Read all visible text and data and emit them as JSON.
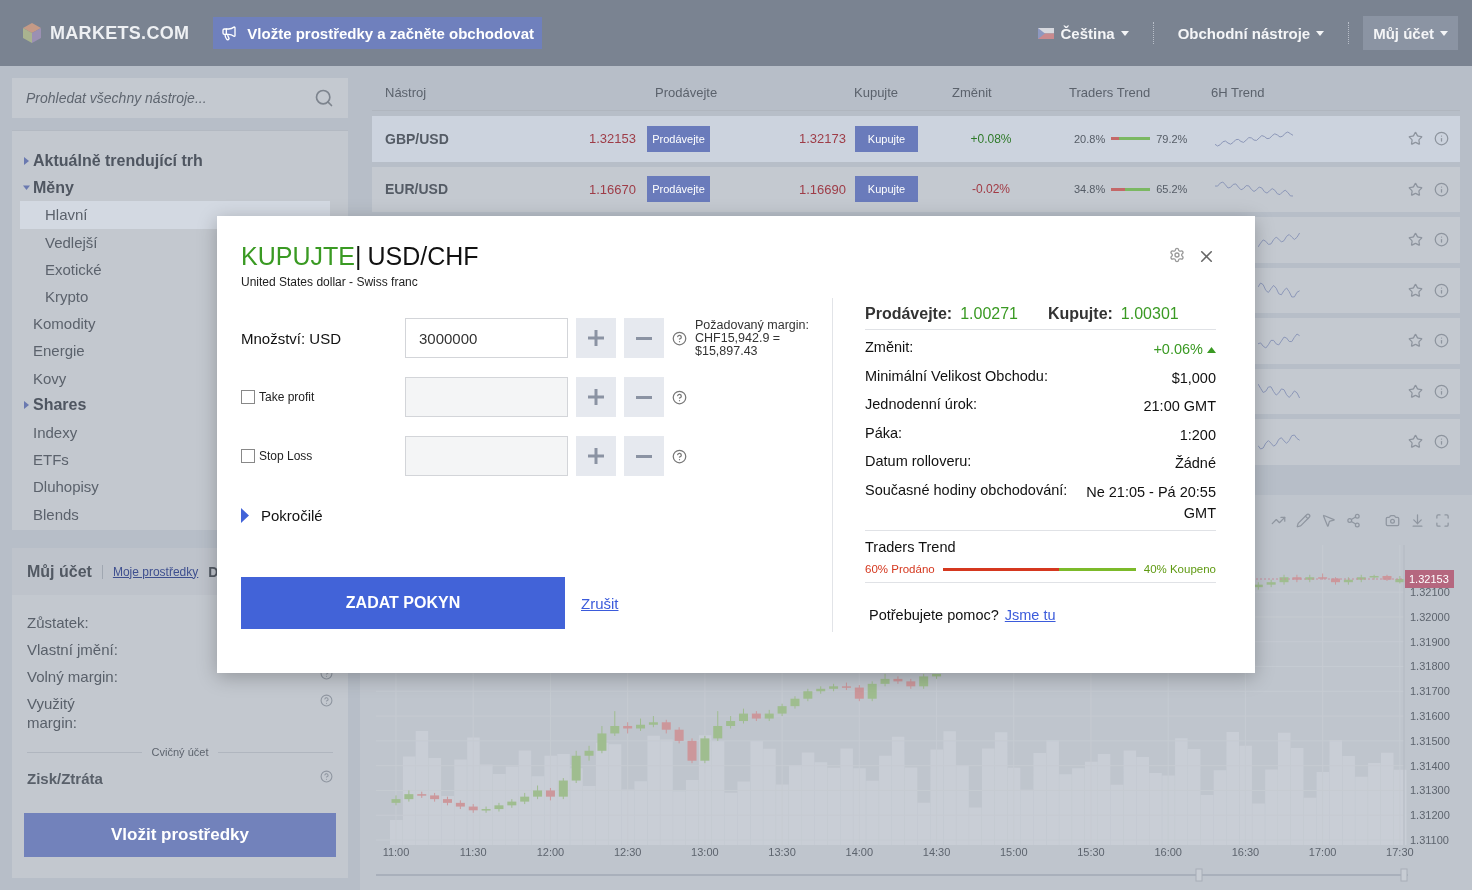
{
  "header": {
    "logo": "MARKETS.COM",
    "promo": "Vložte prostředky a začněte obchodovat",
    "language": "Čeština",
    "menus": [
      {
        "label": "Obchodní nástroje",
        "boxed": false
      },
      {
        "label": "Můj účet",
        "boxed": true
      }
    ]
  },
  "sidebar": {
    "search_placeholder": "Prohledat všechny nástroje...",
    "tree": [
      {
        "kind": "group",
        "label": "Aktuálně trendující trh",
        "expanded": false
      },
      {
        "kind": "group",
        "label": "Měny",
        "expanded": true,
        "children": [
          {
            "label": "Hlavní",
            "selected": true
          },
          {
            "label": "Vedlejší",
            "selected": false
          },
          {
            "label": "Exotické",
            "selected": false
          },
          {
            "label": "Krypto",
            "selected": false
          }
        ]
      },
      {
        "kind": "leaf",
        "label": "Komodity"
      },
      {
        "kind": "leaf",
        "label": "Energie"
      },
      {
        "kind": "leaf",
        "label": "Kovy"
      },
      {
        "kind": "group",
        "label": "Shares",
        "expanded": false
      },
      {
        "kind": "leaf",
        "label": "Indexy"
      },
      {
        "kind": "leaf",
        "label": "ETFs"
      },
      {
        "kind": "leaf",
        "label": "Dluhopisy"
      },
      {
        "kind": "leaf",
        "label": "Blends"
      }
    ]
  },
  "account": {
    "title": "Můj účet",
    "link": "Moje prostředky",
    "cut_tab": "D",
    "fields": [
      {
        "label": "Zůstatek:"
      },
      {
        "label": "Vlastní jmění:"
      },
      {
        "label": "Volný margin:",
        "help": true
      },
      {
        "label": "Využitý margin:",
        "help": true
      }
    ],
    "practice_label": "Cvičný účet",
    "profit": {
      "label": "Zisk/Ztráta",
      "help": true
    },
    "deposit_button": "Vložit prostředky"
  },
  "table": {
    "columns": [
      "Nástroj",
      "Prodávejte",
      "Kupujte",
      "Změnit",
      "Traders Trend",
      "6H Trend"
    ],
    "rows": [
      {
        "kind": "full",
        "instrument": "GBP/USD",
        "sell_price": "1.32153",
        "sell_button": "Prodávejte",
        "buy_price": "1.32173",
        "buy_button": "Kupujte",
        "change": "+0.08%",
        "rising": true,
        "trend_sold": "20.8%",
        "level": 0.208,
        "trend_bought": "79.2%",
        "highlighted": true
      },
      {
        "kind": "full",
        "instrument": "EUR/USD",
        "sell_price": "1.16670",
        "sell_button": "Prodávejte",
        "buy_price": "1.16690",
        "buy_button": "Kupujte",
        "change": "-0.02%",
        "rising": false,
        "trend_sold": "34.8%",
        "level": 0.348,
        "trend_bought": "65.2%",
        "highlighted": false
      },
      {
        "kind": "covered"
      },
      {
        "kind": "covered"
      },
      {
        "kind": "covered"
      },
      {
        "kind": "covered"
      },
      {
        "kind": "covered"
      }
    ]
  },
  "chart": {
    "price_tag": "1.32153",
    "chart_data": {
      "type": "candlestick",
      "grid": true,
      "categories": [
        "11:00",
        null,
        null,
        null,
        null,
        null,
        "11:30",
        null,
        null,
        null,
        null,
        null,
        "12:00",
        null,
        null,
        null,
        null,
        null,
        "12:30",
        null,
        null,
        null,
        null,
        null,
        "13:00",
        null,
        null,
        null,
        null,
        null,
        "13:30",
        null,
        null,
        null,
        null,
        null,
        "14:00",
        null,
        null,
        null,
        null,
        null,
        "14:30",
        null,
        null,
        null,
        null,
        null,
        "15:00",
        null,
        null,
        null,
        null,
        null,
        "15:30",
        null,
        null,
        null,
        null,
        null,
        "16:00",
        null,
        null,
        null,
        null,
        null,
        "16:30",
        null,
        null,
        null,
        null,
        null,
        "17:00",
        null,
        null,
        null,
        null,
        null,
        "17:30"
      ],
      "ohlc": [
        [
          1.3125,
          1.3128,
          1.3124,
          1.31265
        ],
        [
          1.31265,
          1.313,
          1.31255,
          1.31285
        ],
        [
          1.31285,
          1.31295,
          1.3127,
          1.3128
        ],
        [
          1.3128,
          1.3129,
          1.31255,
          1.31265
        ],
        [
          1.31265,
          1.31275,
          1.3124,
          1.3125
        ],
        [
          1.3125,
          1.3126,
          1.31225,
          1.31235
        ],
        [
          1.31235,
          1.31245,
          1.3121,
          1.3122
        ],
        [
          1.3122,
          1.31235,
          1.3121,
          1.31225
        ],
        [
          1.31225,
          1.3125,
          1.31215,
          1.3124
        ],
        [
          1.3124,
          1.31265,
          1.3123,
          1.31255
        ],
        [
          1.31255,
          1.3129,
          1.31245,
          1.31275
        ],
        [
          1.31275,
          1.3132,
          1.31265,
          1.313
        ],
        [
          1.313,
          1.3131,
          1.3126,
          1.31275
        ],
        [
          1.31275,
          1.3135,
          1.31265,
          1.3134
        ],
        [
          1.3134,
          1.3146,
          1.3133,
          1.3144
        ],
        [
          1.3144,
          1.3148,
          1.3142,
          1.3146
        ],
        [
          1.3146,
          1.3156,
          1.3145,
          1.3153
        ],
        [
          1.3153,
          1.3162,
          1.3152,
          1.3156
        ],
        [
          1.3156,
          1.31575,
          1.3153,
          1.3155
        ],
        [
          1.3155,
          1.3159,
          1.3154,
          1.31565
        ],
        [
          1.31565,
          1.316,
          1.31555,
          1.31575
        ],
        [
          1.31575,
          1.31585,
          1.3153,
          1.31545
        ],
        [
          1.31545,
          1.31555,
          1.3149,
          1.315
        ],
        [
          1.315,
          1.3151,
          1.3141,
          1.3142
        ],
        [
          1.3142,
          1.3152,
          1.3141,
          1.3151
        ],
        [
          1.3151,
          1.3162,
          1.315,
          1.3156
        ],
        [
          1.3156,
          1.316,
          1.3155,
          1.3158
        ],
        [
          1.3158,
          1.3163,
          1.3157,
          1.3161
        ],
        [
          1.3161,
          1.3162,
          1.3158,
          1.3159
        ],
        [
          1.3159,
          1.31625,
          1.3158,
          1.3161
        ],
        [
          1.3161,
          1.3165,
          1.316,
          1.3164
        ],
        [
          1.3164,
          1.3168,
          1.3163,
          1.3167
        ],
        [
          1.3167,
          1.3171,
          1.3166,
          1.317
        ],
        [
          1.317,
          1.3172,
          1.3169,
          1.3171
        ],
        [
          1.3171,
          1.3173,
          1.317,
          1.3172
        ],
        [
          1.3172,
          1.31735,
          1.31705,
          1.31715
        ],
        [
          1.31715,
          1.31725,
          1.3166,
          1.3167
        ],
        [
          1.3167,
          1.3174,
          1.3166,
          1.3173
        ],
        [
          1.3173,
          1.3177,
          1.3172,
          1.3175
        ],
        [
          1.3175,
          1.3176,
          1.3173,
          1.3174
        ],
        [
          1.3174,
          1.3175,
          1.3171,
          1.3172
        ],
        [
          1.3172,
          1.3177,
          1.3171,
          1.3176
        ],
        [
          1.3176,
          1.3177,
          1.3175,
          1.3177
        ],
        null,
        null,
        null,
        null,
        null,
        null,
        null,
        null,
        null,
        null,
        null,
        null,
        null,
        null,
        null,
        null,
        null,
        null,
        null,
        null,
        null,
        null,
        null,
        null,
        [
          1.3212,
          1.3214,
          1.3211,
          1.3213
        ],
        [
          1.3213,
          1.3215,
          1.3212,
          1.3214
        ],
        [
          1.3214,
          1.3217,
          1.3213,
          1.3216
        ],
        [
          1.3216,
          1.3217,
          1.3214,
          1.3215
        ],
        [
          1.3215,
          1.3217,
          1.3214,
          1.3216
        ],
        [
          1.3216,
          1.32175,
          1.3215,
          1.32155
        ],
        [
          1.32155,
          1.3216,
          1.3213,
          1.3214
        ],
        [
          1.3214,
          1.3216,
          1.3213,
          1.3215
        ],
        [
          1.3215,
          1.3217,
          1.3214,
          1.3216
        ],
        [
          1.3216,
          1.3217,
          1.3215,
          1.32165
        ],
        [
          1.32165,
          1.3217,
          1.32145,
          1.3215
        ],
        [
          1.3214,
          1.32165,
          1.32135,
          1.32153
        ]
      ],
      "ylim": [
        1.3108,
        1.3229
      ],
      "yticks": [
        {
          "value": 1.321,
          "label": "1.32100"
        },
        {
          "value": 1.32,
          "label": "1.32000"
        },
        {
          "value": 1.319,
          "label": "1.31900"
        },
        {
          "value": 1.318,
          "label": "1.31800"
        },
        {
          "value": 1.317,
          "label": "1.31700"
        },
        {
          "value": 1.316,
          "label": "1.31600"
        },
        {
          "value": 1.315,
          "label": "1.31500"
        },
        {
          "value": 1.314,
          "label": "1.31400"
        },
        {
          "value": 1.313,
          "label": "1.31300"
        },
        {
          "value": 1.312,
          "label": "1.31200"
        },
        {
          "value": 1.311,
          "label": "1.31100"
        }
      ]
    }
  },
  "modal": {
    "action": "KUPUJTE",
    "separator": "|",
    "instrument": "USD/CHF",
    "description": "United States dollar - Swiss franc",
    "fields": [
      {
        "kind": "quantity",
        "label": "Množství: USD",
        "value": "3000000",
        "note": "Požadovaný margin: CHF15,942.9 = $15,897.43"
      },
      {
        "kind": "optional",
        "label": "Take profit",
        "checked": false
      },
      {
        "kind": "optional",
        "label": "Stop Loss",
        "checked": false
      }
    ],
    "advanced": {
      "label": "Pokročilé",
      "expanded": false
    },
    "submit": "ZADAT POKYN",
    "cancel": "Zrušit",
    "sell_label": "Prodávejte:",
    "sell_price": "1.00271",
    "buy_label": "Kupujte:",
    "buy_price": "1.00301",
    "details": [
      {
        "kind": "change",
        "label": "Změnit:",
        "value": "+0.06%",
        "rising": true
      },
      {
        "kind": "plain",
        "label": "Minimální Velikost Obchodu:",
        "value": "$1,000"
      },
      {
        "kind": "plain",
        "label": "Jednodenní úrok:",
        "value": "21:00 GMT"
      },
      {
        "kind": "plain",
        "label": "Páka:",
        "value": "1:200"
      },
      {
        "kind": "plain",
        "label": "Datum rolloveru:",
        "value": "Žádné"
      },
      {
        "kind": "plain",
        "label": "Současné hodiny obchodování:",
        "value": "Ne 21:05 - Pá 20:55 GMT"
      }
    ],
    "trend_title": "Traders Trend",
    "trend_sold": "60% Prodáno",
    "level": 0.6,
    "trend_bought": "40% Koupeno",
    "help_text": "Potřebujete pomoc?",
    "help_link": "Jsme tu"
  }
}
